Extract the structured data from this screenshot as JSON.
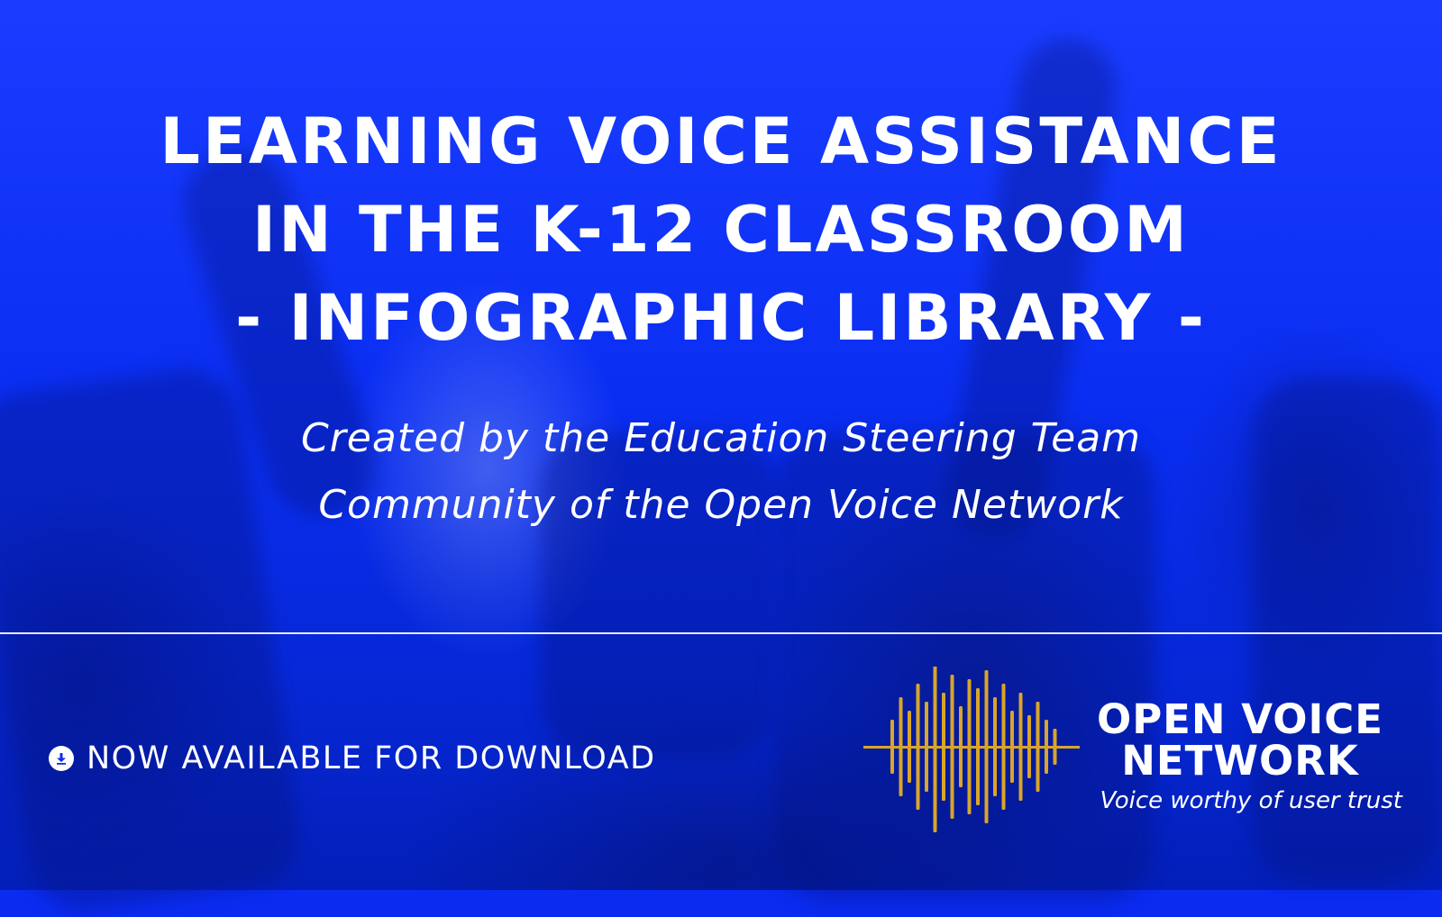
{
  "colors": {
    "background": "#0a2bf0",
    "text": "#ffffff",
    "logo_gold": "#d9a52a"
  },
  "title": {
    "line1": "LEARNING VOICE ASSISTANCE",
    "line2": "IN THE K-12 CLASSROOM",
    "line3": "- INFOGRAPHIC LIBRARY -"
  },
  "subtitle": {
    "line1": "Created by the Education Steering Team",
    "line2": "Community of the Open Voice Network"
  },
  "download": {
    "icon": "download-icon",
    "label": "NOW AVAILABLE FOR DOWNLOAD"
  },
  "logo": {
    "icon": "sound-wave-icon",
    "name_line1": "OPEN VOICE",
    "name_line2": "NETWORK",
    "tagline": "Voice worthy of user trust"
  }
}
